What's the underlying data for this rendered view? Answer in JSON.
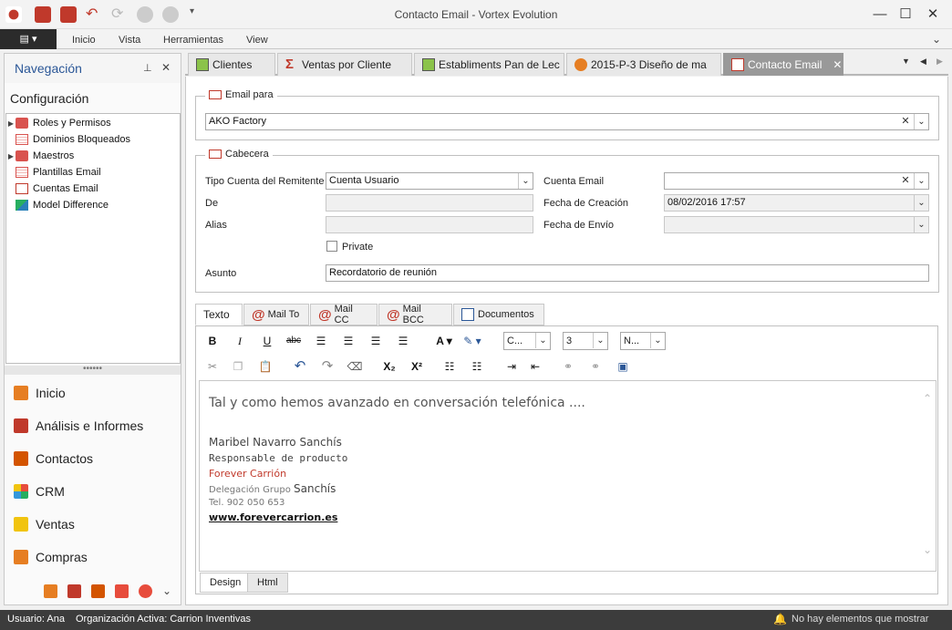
{
  "window": {
    "title": "Contacto Email - Vortex Evolution"
  },
  "menu": {
    "items": [
      "Inicio",
      "Vista",
      "Herramientas",
      "View"
    ]
  },
  "nav": {
    "title": "Navegación",
    "section": "Configuración",
    "tree": [
      "Roles y Permisos",
      "Dominios Bloqueados",
      "Maestros",
      "Plantillas Email",
      "Cuentas Email",
      "Model Difference"
    ],
    "groups": [
      "Inicio",
      "Análisis e Informes",
      "Contactos",
      "CRM",
      "Ventas",
      "Compras"
    ],
    "splitter": "••••••"
  },
  "tabs": [
    "Clientes",
    "Ventas por Cliente",
    "Establiments Pan de Lec",
    "2015-P-3 Diseño de ma",
    "Contacto Email"
  ],
  "form": {
    "email_para": {
      "label": "Email para",
      "value": "AKO Factory"
    },
    "cabecera": {
      "label": "Cabecera",
      "tipo_cuenta_label": "Tipo Cuenta del Remitente",
      "tipo_cuenta_value": "Cuenta Usuario",
      "cuenta_email_label": "Cuenta Email",
      "cuenta_email_value": "",
      "de_label": "De",
      "fecha_creacion_label": "Fecha de Creación",
      "fecha_creacion_value": "08/02/2016 17:57",
      "alias_label": "Alias",
      "fecha_envio_label": "Fecha de Envío",
      "private_label": "Private",
      "asunto_label": "Asunto",
      "asunto_value": "Recordatorio de reunión"
    }
  },
  "editor": {
    "tabs": [
      "Texto",
      "Mail To",
      "Mail CC",
      "Mail BCC",
      "Documentos"
    ],
    "font_name": "C...",
    "font_size": "3",
    "style": "N...",
    "body": {
      "line1": "Tal y como hemos avanzado en conversación telefónica ....",
      "name": "Maribel Navarro Sanchís",
      "role": "Responsable de producto",
      "company": "Forever Carrión",
      "delegation_prefix": "Delegación Grupo",
      "delegation_name": "Sanchís",
      "tel": "Tel. 902 050 653",
      "web": "www.forevercarrion.es"
    },
    "bottom_tabs": [
      "Design",
      "Html"
    ]
  },
  "status": {
    "user": "Usuario: Ana",
    "org": "Organización Activa: Carrion Inventivas",
    "notif": "No hay elementos que mostrar"
  },
  "colors": {
    "accent": "#2b5797",
    "red": "#c0392b",
    "active_tab": "#999999"
  }
}
